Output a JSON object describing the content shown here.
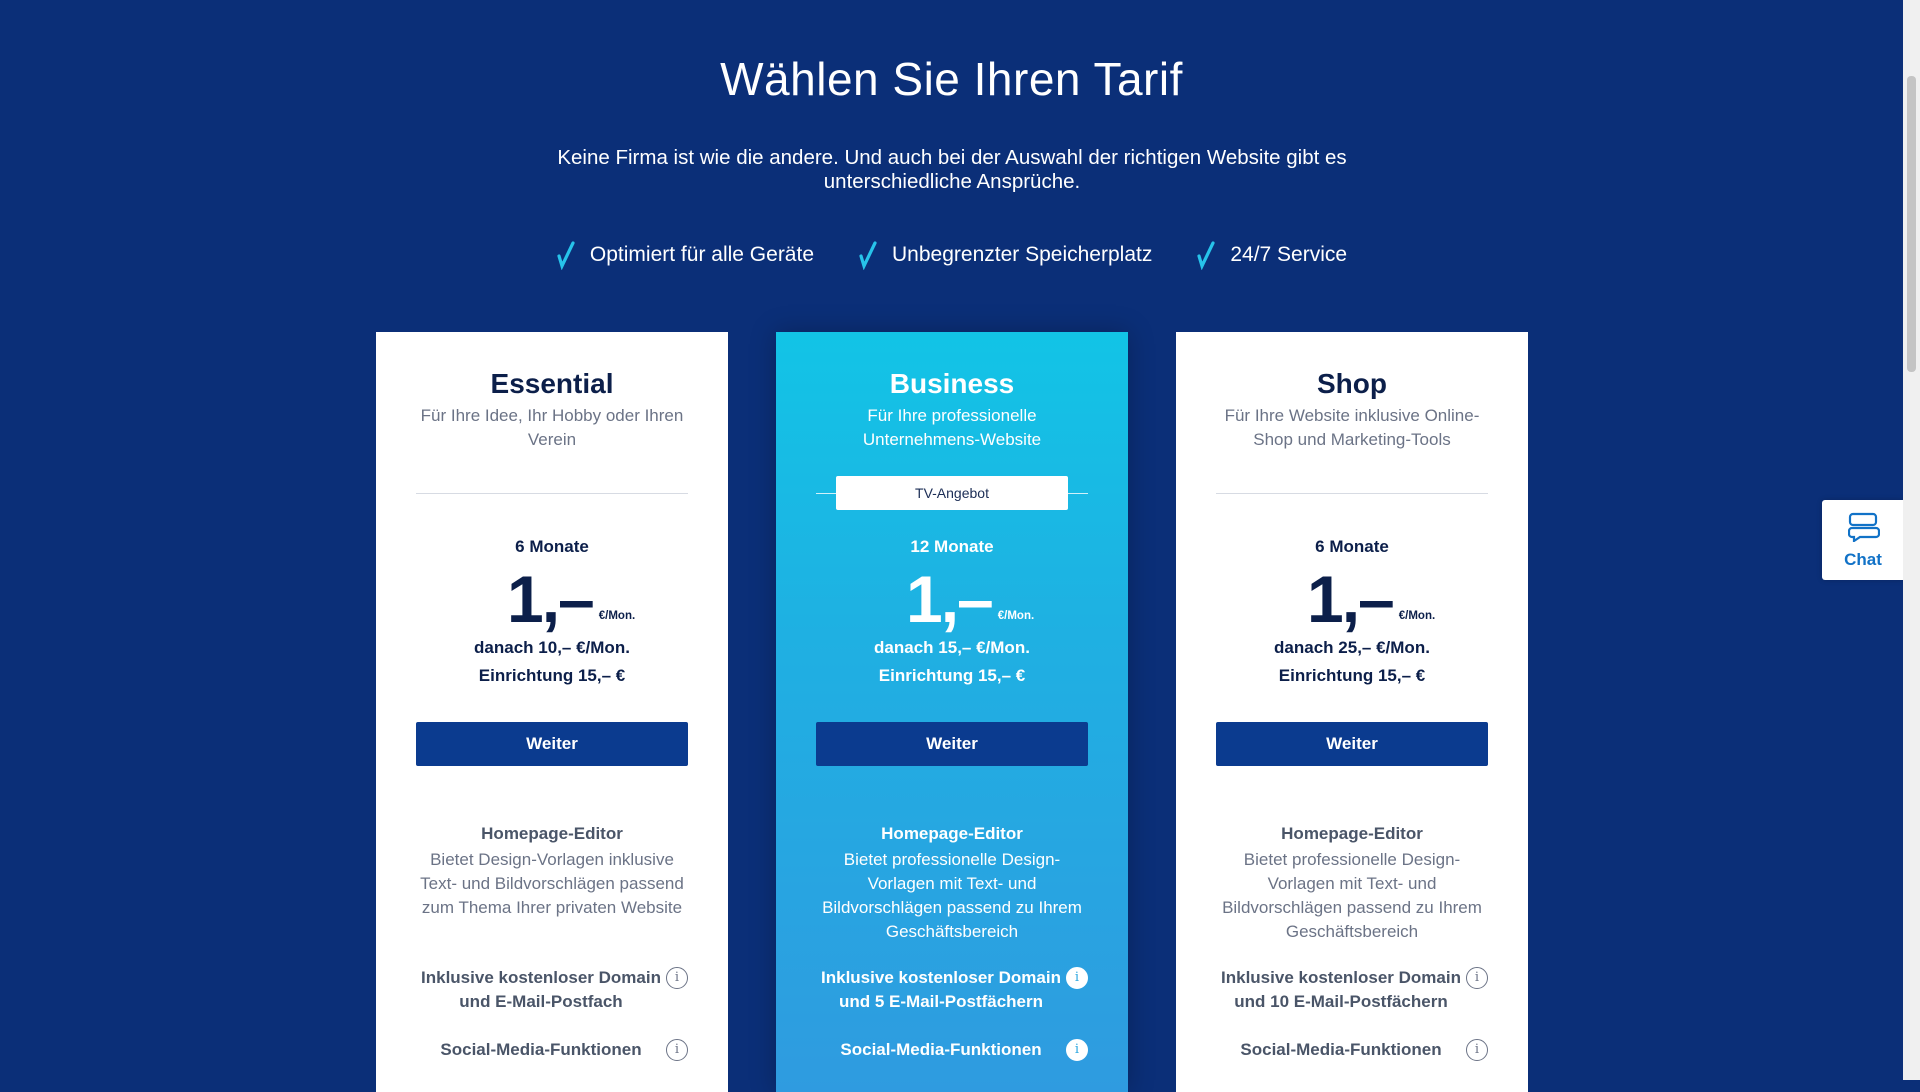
{
  "header": {
    "title": "Wählen Sie Ihren Tarif",
    "subtitle": "Keine Firma ist wie die andere. Und auch bei der Auswahl der richtigen Website gibt es unterschiedliche Ansprüche."
  },
  "features": [
    {
      "icon": "checkmark-icon",
      "label": "Optimiert für alle Geräte"
    },
    {
      "icon": "checkmark-icon",
      "label": "Unbegrenzter Speicherplatz"
    },
    {
      "icon": "checkmark-icon",
      "label": "24/7 Service"
    }
  ],
  "plans": [
    {
      "name": "Essential",
      "description": "Für Ihre Idee, Ihr Hobby oder Ihren Verein",
      "months": "6 Monate",
      "price": "1,–",
      "unit": "€/Mon.",
      "after": "danach 10,– €/Mon.",
      "setup": "Einrichtung 15,– €",
      "button": "Weiter",
      "editor_title": "Homepage-Editor",
      "editor_desc": "Bietet Design-Vorlagen inklusive Text- und Bildvorschlägen passend zum Thema Ihrer privaten Website",
      "domain": "Inklusive kostenloser Domain und E-Mail-Postfach",
      "social": "Social-Media-Funktionen"
    },
    {
      "name": "Business",
      "description": "Für Ihre professionelle Unternehmens-Website",
      "badge": "TV-Angebot",
      "months": "12 Monate",
      "price": "1,–",
      "unit": "€/Mon.",
      "after": "danach 15,– €/Mon.",
      "setup": "Einrichtung 15,– €",
      "button": "Weiter",
      "editor_title": "Homepage-Editor",
      "editor_desc": "Bietet professionelle Design-Vorlagen mit Text- und Bildvorschlägen passend zu Ihrem Geschäftsbereich",
      "domain": "Inklusive kostenloser Domain und 5 E-Mail-Postfächern",
      "social": "Social-Media-Funktionen"
    },
    {
      "name": "Shop",
      "description": "Für Ihre Website inklusive Online-Shop und Marketing-Tools",
      "months": "6 Monate",
      "price": "1,–",
      "unit": "€/Mon.",
      "after": "danach 25,– €/Mon.",
      "setup": "Einrichtung 15,– €",
      "button": "Weiter",
      "editor_title": "Homepage-Editor",
      "editor_desc": "Bietet professionelle Design-Vorlagen mit Text- und Bildvorschlägen passend zu Ihrem Geschäftsbereich",
      "domain": "Inklusive kostenloser Domain und 10 E-Mail-Postfächern",
      "social": "Social-Media-Funktionen"
    }
  ],
  "info_glyph": "i",
  "chat": {
    "label": "Chat",
    "icon": "chat-icon"
  },
  "colors": {
    "background": "#0b2f78",
    "button": "#0b3b8f",
    "highlight_gradient_top": "#12c4e6",
    "highlight_gradient_bottom": "#2f9be0",
    "check": "#27c3ea"
  }
}
